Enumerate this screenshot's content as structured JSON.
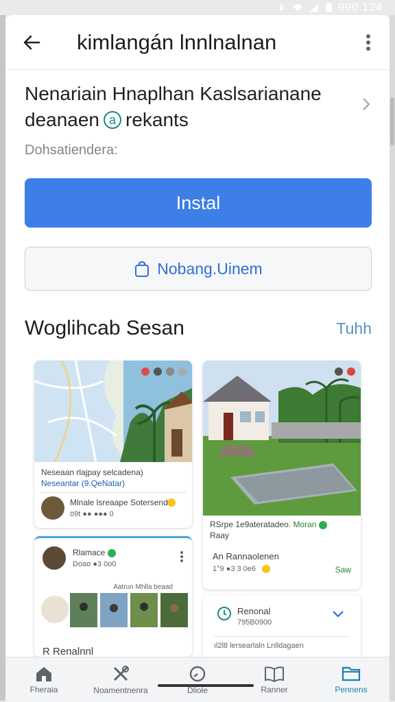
{
  "status_bar": {
    "time": "990 124"
  },
  "app_bar": {
    "title": "kimlangán lnnlnalnan"
  },
  "app_info": {
    "title": "Nenariain Hnaplhan Kaslsarianane",
    "subtitle": "deanaen",
    "subtitle_badge": "͡",
    "subtitle_rest": "rekants",
    "meta": "Dohsatiendera:"
  },
  "install_label": "Instal",
  "secondary_label": "Nobang.Uinem",
  "section": {
    "title": "Woglihcab Sesan",
    "link": "Tuhh"
  },
  "cards": {
    "map_card": {
      "line1": "Neseaan rlajpay selcadena)",
      "line2": "Neseantar (9.QeNatar)",
      "user_line": "Mlnale lsreaape Sotersend",
      "stats": "ö9t   ●● ●●● 0"
    },
    "house_card": {
      "caption1": "RSrpe 1e9ateratadeo.",
      "caption1_green": "Moran",
      "caption2": "Raay",
      "title": "An Rannaolenen",
      "stats": "1°9  ●3 3 0e6",
      "action": "Saw"
    },
    "profile_card": {
      "name": "Rlamace",
      "stats": "Doao  ●3 0o0",
      "strip_label": "Aatrun Mhlla beaad"
    },
    "reminder_card": {
      "title": "Renonal",
      "sub": "795B0900",
      "footer": "ıl2l8 lersearlaln Lnlldagaen"
    },
    "peek_card": {
      "title": "R Renalnnl"
    }
  },
  "bottom_nav": [
    {
      "label": "Fheraia",
      "icon": "home-icon"
    },
    {
      "label": "Noamentnenra",
      "icon": "tools-icon"
    },
    {
      "label": "Dliole",
      "icon": "clock-icon"
    },
    {
      "label": "Ranner",
      "icon": "book-icon"
    },
    {
      "label": "Pennens",
      "icon": "folder-icon"
    }
  ],
  "colors": {
    "accent": "#3d7fe6",
    "active_nav": "#1a7fb0",
    "link": "#2f6fd6"
  }
}
